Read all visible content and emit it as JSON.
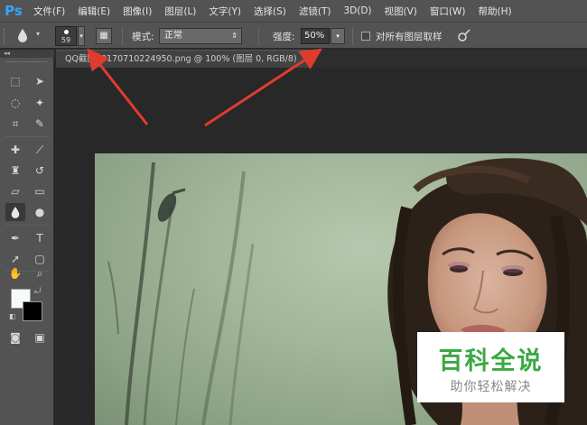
{
  "app": {
    "logo": "Ps"
  },
  "menu": [
    "文件(F)",
    "编辑(E)",
    "图像(I)",
    "图层(L)",
    "文字(Y)",
    "选择(S)",
    "滤镜(T)",
    "3D(D)",
    "视图(V)",
    "窗口(W)",
    "帮助(H)"
  ],
  "options": {
    "tool_icon": "blur-drop-icon",
    "brush_size": "59",
    "mode_label": "模式:",
    "mode_value": "正常",
    "strength_label": "强度:",
    "strength_value": "50%",
    "sample_all_label": "对所有图层取样",
    "sample_all_checked": false
  },
  "document": {
    "tab_title": "QQ截图20170710224950.png @ 100% (图层 0, RGB/8)",
    "tab_close": "×"
  },
  "swatches": {
    "foreground": "#f4fbfb",
    "background": "#000000"
  },
  "watermark": {
    "title": "百科全说",
    "subtitle": "助你轻松解决",
    "color": "#3aa843"
  },
  "annotations": {
    "arrow_color": "#e03c2e"
  }
}
